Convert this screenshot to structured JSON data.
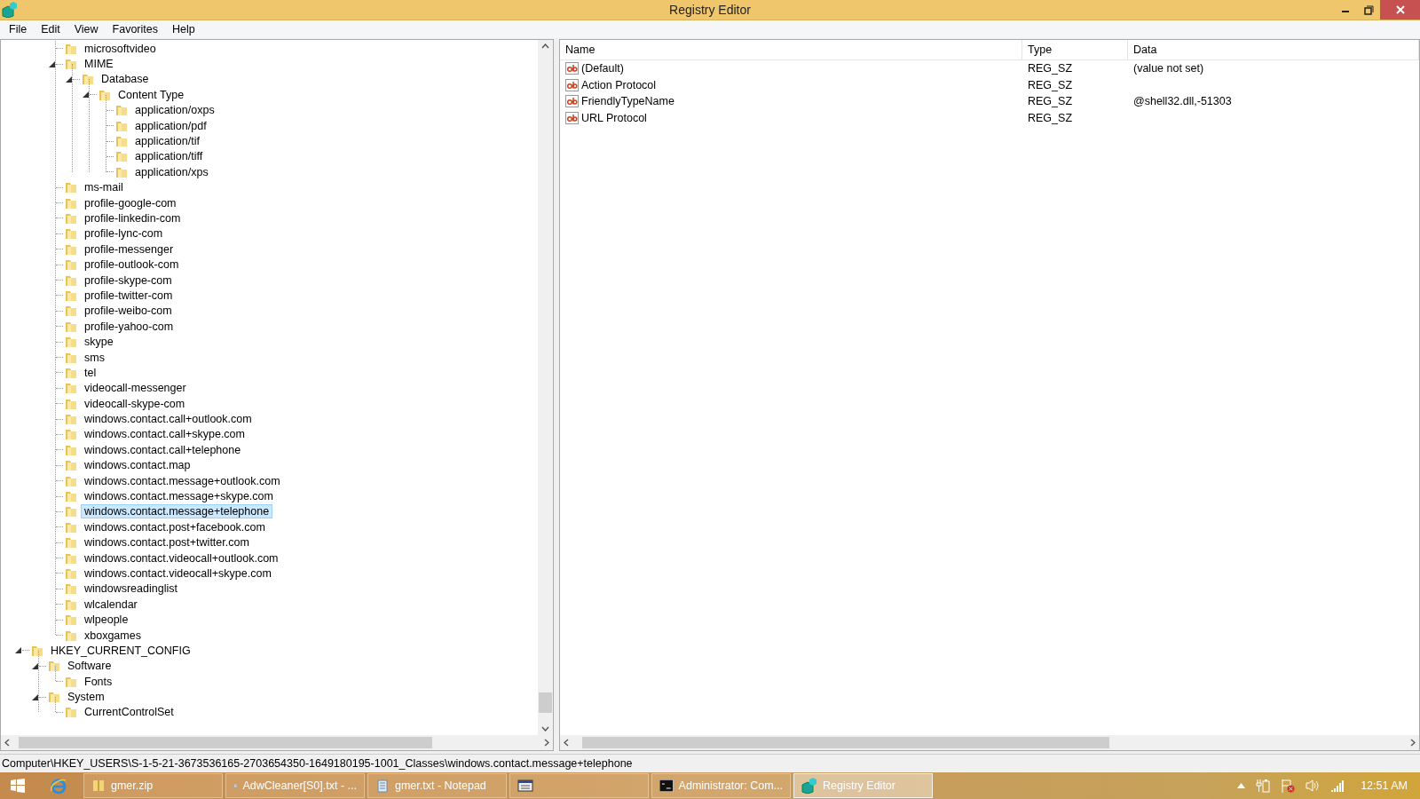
{
  "window": {
    "title": "Registry Editor"
  },
  "menu": [
    "File",
    "Edit",
    "View",
    "Favorites",
    "Help"
  ],
  "tree": {
    "partial_branch": [
      {
        "label": "microsoftvideo",
        "selected": false
      },
      {
        "label": "MIME",
        "selected": false,
        "expanded": true,
        "children": [
          {
            "label": "Database",
            "selected": false,
            "expanded": true,
            "children": [
              {
                "label": "Content Type",
                "selected": false,
                "expanded": true,
                "children": [
                  {
                    "label": "application/oxps",
                    "selected": false
                  },
                  {
                    "label": "application/pdf",
                    "selected": false
                  },
                  {
                    "label": "application/tif",
                    "selected": false
                  },
                  {
                    "label": "application/tiff",
                    "selected": false
                  },
                  {
                    "label": "application/xps",
                    "selected": false
                  }
                ]
              }
            ]
          }
        ]
      },
      {
        "label": "ms-mail",
        "selected": false
      },
      {
        "label": "profile-google-com",
        "selected": false
      },
      {
        "label": "profile-linkedin-com",
        "selected": false
      },
      {
        "label": "profile-lync-com",
        "selected": false
      },
      {
        "label": "profile-messenger",
        "selected": false
      },
      {
        "label": "profile-outlook-com",
        "selected": false
      },
      {
        "label": "profile-skype-com",
        "selected": false
      },
      {
        "label": "profile-twitter-com",
        "selected": false
      },
      {
        "label": "profile-weibo-com",
        "selected": false
      },
      {
        "label": "profile-yahoo-com",
        "selected": false
      },
      {
        "label": "skype",
        "selected": false
      },
      {
        "label": "sms",
        "selected": false
      },
      {
        "label": "tel",
        "selected": false
      },
      {
        "label": "videocall-messenger",
        "selected": false
      },
      {
        "label": "videocall-skype-com",
        "selected": false
      },
      {
        "label": "windows.contact.call+outlook.com",
        "selected": false
      },
      {
        "label": "windows.contact.call+skype.com",
        "selected": false
      },
      {
        "label": "windows.contact.call+telephone",
        "selected": false
      },
      {
        "label": "windows.contact.map",
        "selected": false
      },
      {
        "label": "windows.contact.message+outlook.com",
        "selected": false
      },
      {
        "label": "windows.contact.message+skype.com",
        "selected": false
      },
      {
        "label": "windows.contact.message+telephone",
        "selected": true
      },
      {
        "label": "windows.contact.post+facebook.com",
        "selected": false
      },
      {
        "label": "windows.contact.post+twitter.com",
        "selected": false
      },
      {
        "label": "windows.contact.videocall+outlook.com",
        "selected": false
      },
      {
        "label": "windows.contact.videocall+skype.com",
        "selected": false
      },
      {
        "label": "windowsreadinglist",
        "selected": false
      },
      {
        "label": "wlcalendar",
        "selected": false
      },
      {
        "label": "wlpeople",
        "selected": false
      },
      {
        "label": "xboxgames",
        "selected": false
      }
    ],
    "items": [
      {
        "label": "HKEY_CURRENT_CONFIG",
        "selected": false,
        "expanded": true,
        "children": [
          {
            "label": "Software",
            "selected": false,
            "expanded": true,
            "children": [
              {
                "label": "Fonts",
                "selected": false
              }
            ]
          },
          {
            "label": "System",
            "selected": false,
            "expanded": true,
            "children": [
              {
                "label": "CurrentControlSet",
                "selected": false
              }
            ]
          }
        ]
      }
    ]
  },
  "values": {
    "columns": [
      "Name",
      "Type",
      "Data"
    ],
    "rows": [
      {
        "name": "(Default)",
        "type": "REG_SZ",
        "data": "(value not set)"
      },
      {
        "name": "Action Protocol",
        "type": "REG_SZ"
      },
      {
        "name": "FriendlyTypeName",
        "type": "REG_SZ",
        "data": "@shell32.dll,-51303"
      },
      {
        "name": "URL Protocol",
        "type": "REG_SZ"
      }
    ]
  },
  "status_bar": "Computer\\HKEY_USERS\\S-1-5-21-3673536165-2703654350-1649180195-1001_Classes\\windows.contact.message+telephone",
  "taskbar": {
    "buttons": [
      {
        "label": "gmer.zip",
        "kind": "zip",
        "selected": false
      },
      {
        "label": "AdwCleaner[S0].txt - ...",
        "kind": "notepad",
        "selected": false
      },
      {
        "label": "gmer.txt - Notepad",
        "kind": "notepad",
        "selected": false
      },
      {
        "kind": "app",
        "selected": false
      },
      {
        "label": "Administrator: Com...",
        "kind": "console",
        "selected": false
      },
      {
        "label": "Registry Editor",
        "kind": "regedit",
        "selected": true
      }
    ],
    "clock": "12:51 AM"
  }
}
